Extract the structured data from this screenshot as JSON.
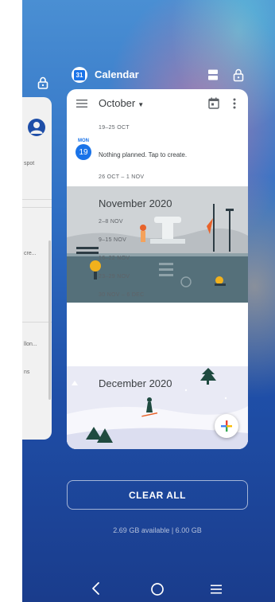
{
  "prev_app": {
    "texts": [
      "spot",
      "cre...",
      "llon...",
      "ns"
    ]
  },
  "app": {
    "name": "Calendar",
    "icon_text": "31"
  },
  "calendar": {
    "month_dropdown": "October",
    "weeks_top": {
      "w1": "19–25 OCT",
      "w2": "26 OCT – 1 NOV"
    },
    "today": {
      "day_name": "MON",
      "day_num": "19",
      "empty_text": "Nothing planned. Tap to create."
    },
    "november": {
      "title": "November 2020",
      "weeks": [
        "2–8 NOV",
        "9–15 NOV",
        "16–22 NOV",
        "23–29 NOV",
        "30 NOV – 6 DEC"
      ]
    },
    "december": {
      "title": "December 2020"
    }
  },
  "recents": {
    "clear_all": "CLEAR ALL",
    "memory": "2.69 GB available | 6.00 GB"
  },
  "colors": {
    "accent": "#1a73e8",
    "banner_grey": "#cfd3d6",
    "banner_street": "#55707a"
  }
}
